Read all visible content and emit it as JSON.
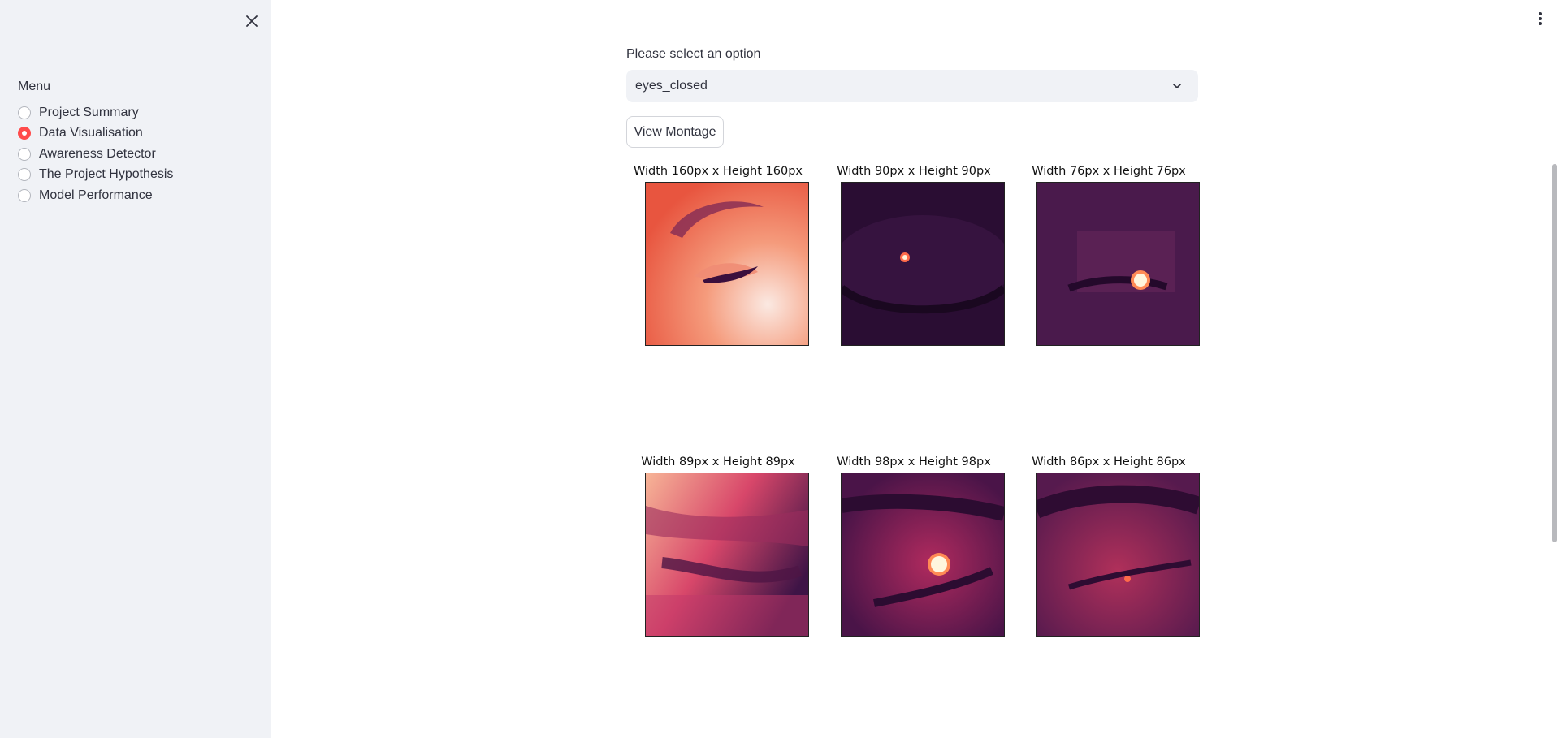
{
  "sidebar": {
    "menu_label": "Menu",
    "items": [
      {
        "label": "Project Summary",
        "selected": false
      },
      {
        "label": "Data Visualisation",
        "selected": true
      },
      {
        "label": "Awareness Detector",
        "selected": false
      },
      {
        "label": "The Project Hypothesis",
        "selected": false
      },
      {
        "label": "Model Performance",
        "selected": false
      }
    ]
  },
  "main": {
    "select_label": "Please select an option",
    "select_value": "eyes_closed",
    "button_label": "View Montage",
    "montage": [
      {
        "caption": "Width 160px x Height 160px"
      },
      {
        "caption": "Width 90px x Height 90px"
      },
      {
        "caption": "Width 76px x Height 76px"
      },
      {
        "caption": "Width 89px x Height 89px"
      },
      {
        "caption": "Width 98px x Height 98px"
      },
      {
        "caption": "Width 86px x Height 86px"
      }
    ]
  },
  "colors": {
    "accent": "#ff4b4b",
    "sidebar_bg": "#f0f2f6",
    "text": "#31333f"
  },
  "icons": {
    "close": "close-icon",
    "more": "more-vertical-icon",
    "dropdown": "chevron-down-icon"
  }
}
